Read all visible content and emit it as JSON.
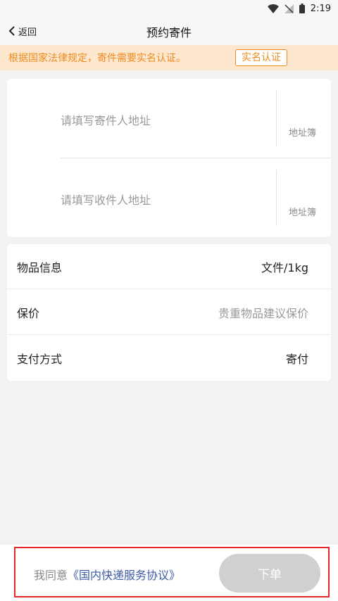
{
  "status_bar": {
    "time": "2:19",
    "icons": [
      "wifi-icon",
      "signal-icon",
      "battery-icon"
    ]
  },
  "header": {
    "back_label": "返回",
    "title": "预约寄件"
  },
  "notice": {
    "text": "根据国家法律规定，寄件需要实名认证。",
    "button": "实名认证"
  },
  "address": {
    "sender_placeholder": "请填写寄件人地址",
    "receiver_placeholder": "请填写收件人地址",
    "address_book_label": "地址簿"
  },
  "info": {
    "rows": [
      {
        "label": "物品信息",
        "value": "文件/1kg"
      },
      {
        "label": "保价",
        "value": "贵重物品建议保价"
      },
      {
        "label": "支付方式",
        "value": "寄付"
      }
    ]
  },
  "footer": {
    "agree_prefix": "我同意",
    "agreement_link": "《国内快递服务协议》",
    "submit": "下单"
  },
  "colors": {
    "accent": "#f08a1d",
    "notice_bg": "#fde8cf",
    "link": "#3d5aa8",
    "highlight_frame": "#e5262b",
    "disabled_button": "#d0d0d0"
  }
}
